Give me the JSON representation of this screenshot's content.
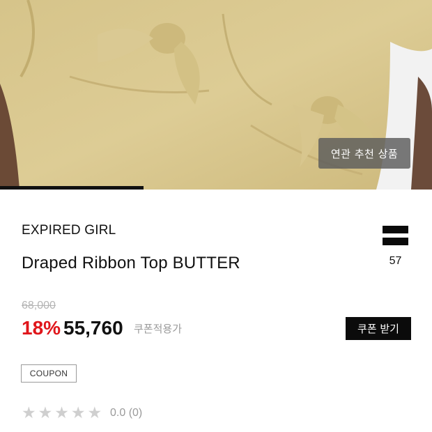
{
  "hero": {
    "related_button_label": "연관 추천 상품",
    "carousel_progress": 0.333
  },
  "product": {
    "brand": "EXPIRED GIRL",
    "title": "Draped Ribbon Top BUTTER",
    "like_count": "57",
    "original_price": "68,000",
    "discount": "18%",
    "sale_price": "55,760",
    "coupon_note": "쿠폰적용가",
    "coupon_button_label": "쿠폰 받기",
    "coupon_badge": "COUPON",
    "rating": {
      "stars_filled": 0,
      "stars_total": 5,
      "text": "0.0 (0)"
    }
  },
  "colors": {
    "discount": "#e0161b",
    "button_bg": "#0b0b0b",
    "muted": "#9a9a9a",
    "fabric": "#d9c88e"
  }
}
